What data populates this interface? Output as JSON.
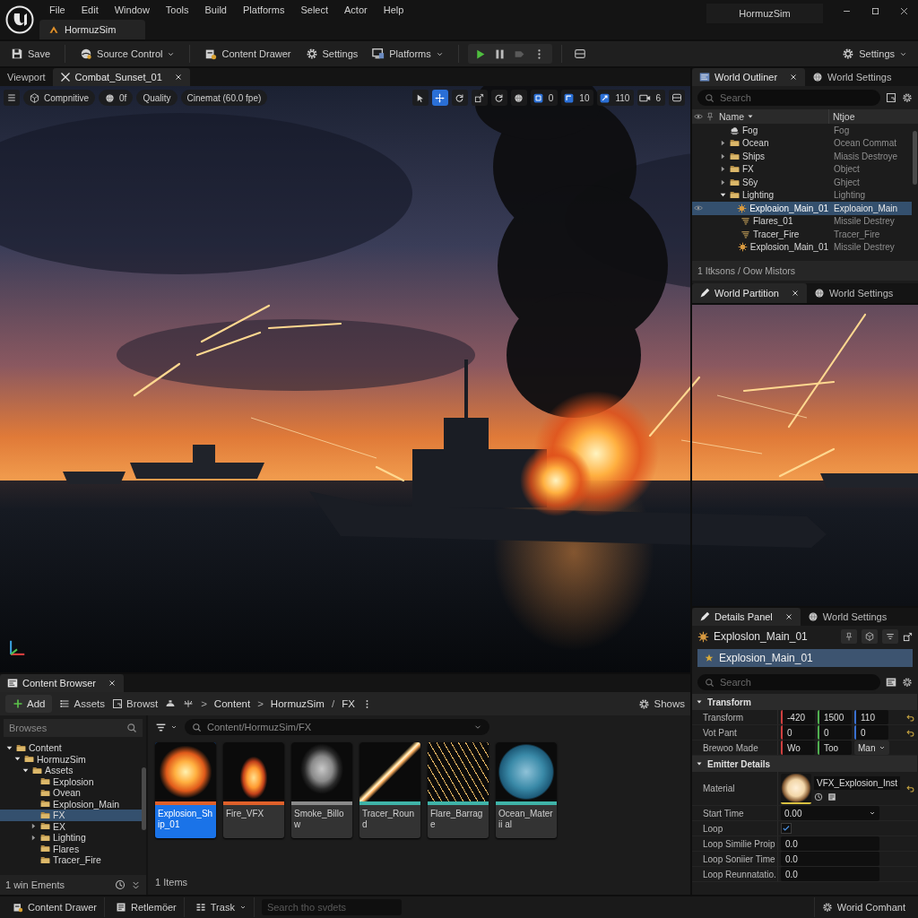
{
  "title_bar": {
    "menus": [
      "File",
      "Edit",
      "Window",
      "Tools",
      "Build",
      "Platforms",
      "Select",
      "Actor",
      "Help"
    ],
    "project_tab": "HormuzSim",
    "window_title": "HormuzSim"
  },
  "toolbar": {
    "items": [
      {
        "label": "Save",
        "kind": "save",
        "dropdown": false
      },
      {
        "label": "Source Control",
        "kind": "source",
        "dropdown": true
      },
      {
        "label": "Content Drawer",
        "kind": "drawer",
        "dropdown": false
      },
      {
        "label": "Settings",
        "kind": "gear",
        "dropdown": false
      },
      {
        "label": "Platforms",
        "kind": "platforms",
        "dropdown": true
      }
    ],
    "settings": {
      "label": "Settings",
      "dropdown": true
    }
  },
  "viewport": {
    "tabs": [
      {
        "label": "Viewport",
        "kind": "plain",
        "selected": false,
        "closable": false
      },
      {
        "label": "Combat_Sunset_01",
        "kind": "level",
        "selected": true,
        "closable": true
      }
    ],
    "options": [
      {
        "label": "Compnitive",
        "kind": "cube"
      },
      {
        "label": "0f",
        "kind": "sphere"
      },
      {
        "label": "Quality",
        "kind": "plain"
      },
      {
        "label": "Cinemat (60.0 fpe)",
        "kind": "plain"
      }
    ],
    "tools": [
      {
        "kind": "select",
        "selected": false
      },
      {
        "kind": "move",
        "selected": true
      },
      {
        "kind": "rotate",
        "selected": false
      },
      {
        "kind": "scale",
        "selected": false
      }
    ],
    "counters": [
      {
        "value": "0",
        "kind": "grid"
      },
      {
        "value": "10",
        "kind": "angle"
      },
      {
        "value": "110",
        "kind": "scale"
      },
      {
        "value": "6",
        "kind": "camera"
      }
    ]
  },
  "outliner": {
    "tabs": [
      {
        "label": "World Outliner",
        "kind": "outliner",
        "selected": true,
        "closable": true
      },
      {
        "label": "World Settings",
        "kind": "globe",
        "selected": false,
        "closable": false
      }
    ],
    "search": {
      "placeholder": "Search"
    },
    "columns": [
      "Name",
      "Ntjoe"
    ],
    "rows": [
      {
        "label": "Fog",
        "type": "Fog",
        "kind": "fog",
        "expandable": false,
        "expanded": false,
        "selected": false
      },
      {
        "label": "Ocean",
        "type": "Ocean Commat",
        "kind": "folder",
        "expandable": true,
        "expanded": false,
        "selected": false
      },
      {
        "label": "Ships",
        "type": "Miasis Destroye",
        "kind": "folder",
        "expandable": true,
        "expanded": false,
        "selected": false
      },
      {
        "label": "FX",
        "type": "Object",
        "kind": "folder",
        "expandable": true,
        "expanded": false,
        "selected": false
      },
      {
        "label": "S6y",
        "type": "Ghject",
        "kind": "folder",
        "expandable": true,
        "expanded": false,
        "selected": false
      },
      {
        "label": "Lighting",
        "type": "Lighting",
        "kind": "folder",
        "expandable": true,
        "expanded": true,
        "selected": false,
        "children": [
          {
            "label": "Exploaion_Main_01",
            "type": "Exploaion_Main",
            "kind": "explosion",
            "expandable": false,
            "expanded": false,
            "selected": true
          },
          {
            "label": "Flares_01",
            "type": "Missile Destrey",
            "kind": "flare",
            "expandable": false,
            "expanded": false,
            "selected": false
          },
          {
            "label": "Tracer_Fire",
            "type": "Tracer_Fire",
            "kind": "flare",
            "expandable": false,
            "expanded": false,
            "selected": false
          },
          {
            "label": "Explosion_Main_01",
            "type": "Missile Destrey",
            "kind": "explosion",
            "expandable": false,
            "expanded": false,
            "selected": false
          }
        ]
      }
    ],
    "footer": "1 Itksons / Oow Mistors",
    "lower_tabs": [
      {
        "label": "World Partition",
        "kind": "details",
        "selected": true,
        "closable": true
      },
      {
        "label": "World Settings",
        "kind": "globe",
        "selected": false,
        "closable": false
      }
    ]
  },
  "details": {
    "tabs": [
      {
        "label": "Details Panel",
        "kind": "details",
        "selected": true,
        "closable": true
      },
      {
        "label": "World Settings",
        "kind": "globe",
        "selected": false,
        "closable": false
      }
    ],
    "object_name": "Exploslon_Main_01",
    "selected_component": "Explosion_Main_01",
    "search": {
      "placeholder": "Search"
    },
    "sections": [
      {
        "title": "Transform",
        "expanded": true,
        "rows": [
          {
            "label": "Transform",
            "kind": "vector",
            "values": [
              "-420",
              "1500",
              "110"
            ],
            "resettable": true
          },
          {
            "label": "Vot Pant",
            "kind": "vector",
            "values": [
              "0",
              "0",
              "0"
            ],
            "resettable": true
          },
          {
            "label": "Brewoo Made",
            "kind": "vector",
            "values": [
              "Wo",
              "Too"
            ],
            "dropdown": "Man",
            "resettable": false
          }
        ]
      },
      {
        "title": "Emitter Details",
        "expanded": true,
        "rows": [
          {
            "label": "Material",
            "kind": "asset",
            "value": "VFX_Explosion_Inst",
            "resettable": true
          },
          {
            "label": "Start Time",
            "kind": "dropdown",
            "value": "0.00",
            "resettable": false
          },
          {
            "label": "Loop",
            "kind": "checkbox",
            "checked": true,
            "resettable": false
          },
          {
            "label": "Loop Similie Proip",
            "kind": "number",
            "value": "0.0",
            "resettable": false
          },
          {
            "label": "Loop Soniier Time",
            "kind": "number",
            "value": "0.0",
            "resettable": false
          },
          {
            "label": "Loop Reunnatatio.",
            "kind": "number",
            "value": "0.0",
            "resettable": false
          }
        ]
      }
    ]
  },
  "content_browser": {
    "tab": {
      "label": "Content Browser",
      "kind": "browser",
      "selected": true,
      "closable": true
    },
    "toolbar": {
      "add": "Add",
      "buttons": [
        "Assets",
        "Browst"
      ],
      "breadcrumb": [
        {
          "label": ">",
          "kind": "separator"
        },
        {
          "label": "Content",
          "kind": "folder"
        },
        {
          "label": ">",
          "kind": "separator"
        },
        {
          "label": "HormuzSim",
          "kind": "folder"
        },
        {
          "label": "/",
          "kind": "separator"
        },
        {
          "label": "FX",
          "kind": "folder"
        }
      ],
      "settings": "Shows"
    },
    "sources": {
      "search": {
        "placeholder": "Browses"
      },
      "tree": [
        {
          "label": "Content",
          "expandable": true,
          "expanded": true,
          "selected": false,
          "children": [
            {
              "label": "HormuzSim",
              "expandable": true,
              "expanded": true,
              "selected": false,
              "children": [
                {
                  "label": "Assets",
                  "expandable": true,
                  "expanded": true,
                  "selected": false,
                  "children": [
                    {
                      "label": "Explosion",
                      "expandable": false,
                      "expanded": false,
                      "selected": false
                    },
                    {
                      "label": "Ovean",
                      "expandable": false,
                      "expanded": false,
                      "selected": false
                    },
                    {
                      "label": "Explosion_Main",
                      "expandable": false,
                      "expanded": false,
                      "selected": false
                    },
                    {
                      "label": "FX",
                      "expandable": false,
                      "expanded": false,
                      "selected": true
                    },
                    {
                      "label": "EX",
                      "expandable": true,
                      "expanded": false,
                      "selected": false
                    },
                    {
                      "label": "Lighting",
                      "expandable": true,
                      "expanded": false,
                      "selected": false
                    },
                    {
                      "label": "Flares",
                      "expandable": false,
                      "expanded": false,
                      "selected": false
                    },
                    {
                      "label": "Tracer_Fire",
                      "expandable": false,
                      "expanded": false,
                      "selected": false
                    }
                  ]
                }
              ]
            }
          ]
        }
      ],
      "footer": "1 win Ements"
    },
    "path_field": {
      "value": "Content/HormuzSim/FX"
    },
    "assets": [
      {
        "name": "Explosion_Ship_01",
        "kind": "explosion",
        "color": "#e0602a",
        "selected": true
      },
      {
        "name": "Fire_VFX",
        "kind": "fire",
        "color": "#e0602a",
        "selected": false
      },
      {
        "name": "Smoke_Billow",
        "kind": "smoke",
        "color": "#8a8a8a",
        "selected": false
      },
      {
        "name": "Tracer_Round",
        "kind": "tracer",
        "color": "#3fb3a8",
        "selected": false
      },
      {
        "name": "Flare_Barrage",
        "kind": "flare",
        "color": "#3fb3a8",
        "selected": false
      },
      {
        "name": "Ocean_Materii al",
        "kind": "ocean",
        "color": "#3fb3a8",
        "selected": false
      }
    ],
    "count": "1 Items"
  },
  "status_bar": {
    "items": [
      {
        "label": "Content Drawer",
        "kind": "drawer",
        "dropdown": false
      },
      {
        "label": "Retlemöer",
        "kind": "log",
        "dropdown": false
      },
      {
        "label": "Trask",
        "kind": "cmd",
        "dropdown": true
      }
    ],
    "command_field": {
      "placeholder": "Search tho svdets"
    },
    "right": "Worid Comhant"
  }
}
